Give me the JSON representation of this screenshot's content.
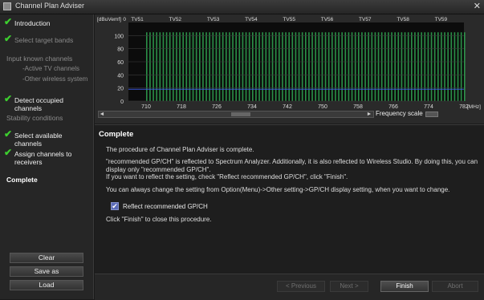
{
  "window": {
    "title": "Channel Plan Adviser",
    "close_glyph": "✕"
  },
  "sidebar": {
    "steps": [
      {
        "label": "Introduction",
        "state": "done"
      },
      {
        "label": "Select target bands",
        "state": "done-dim"
      },
      {
        "label": "Input known channels",
        "state": "dim"
      },
      {
        "label": "Detect occupied channels",
        "state": "done"
      },
      {
        "label": "Stability conditions",
        "state": "dim"
      },
      {
        "label": "Select available channels",
        "state": "done"
      },
      {
        "label": "Assign channels to receivers",
        "state": "done"
      },
      {
        "label": "Complete",
        "state": "active"
      }
    ],
    "substeps": [
      "-Active TV channels",
      "-Other wireless system"
    ],
    "buttons": {
      "clear": "Clear",
      "save_as": "Save as",
      "load": "Load"
    }
  },
  "chart_data": {
    "type": "bar",
    "ylabel": "[dBuVemf]",
    "y_ticks": [
      "100",
      "80",
      "60",
      "40",
      "20",
      "0"
    ],
    "ylim": [
      0,
      120
    ],
    "x_ticks": [
      "710",
      "718",
      "726",
      "734",
      "742",
      "750",
      "758",
      "766",
      "774",
      "782"
    ],
    "xunit": "[MHz]",
    "xlim": [
      706,
      782
    ],
    "tv_channels": [
      "TV51",
      "TV52",
      "TV53",
      "TV54",
      "TV55",
      "TV56",
      "TV57",
      "TV58",
      "TV59"
    ],
    "top_axis_value": "0",
    "grid": true,
    "colors": {
      "bars": "#2e9e4e",
      "bar_highlight": "#4fc06b",
      "threshold": "#3a55d8",
      "plot_bg": "#0c0c0c"
    }
  },
  "scroll": {
    "left_arrow": "◄",
    "right_arrow": "►",
    "thumb_glyph": "|||",
    "frequency_scale_label": "Frequency scale"
  },
  "content": {
    "heading": "Complete",
    "paragraphs": [
      "The procedure of Channel Plan Adviser is complete.",
      "\"recommended GP/CH\" is reflected to Spectrum Analyzer. Additionally, it is also reflected to Wireless Studio. By doing this, you can display only \"recommended GP/CH\".",
      "If you want to reflect the setting, check \"Reflect recommended GP/CH\", click \"Finish\".",
      "You can always change the setting from Option(Menu)->Other setting->GP/CH display setting, when you want to change.",
      "Click \"Finish\" to close this procedure."
    ],
    "checkbox": {
      "label": "Reflect recommended GP/CH",
      "checked": true,
      "glyph": "✔"
    }
  },
  "nav": {
    "previous": "< Previous",
    "next": "Next >",
    "finish": "Finish",
    "abort": "Abort"
  }
}
